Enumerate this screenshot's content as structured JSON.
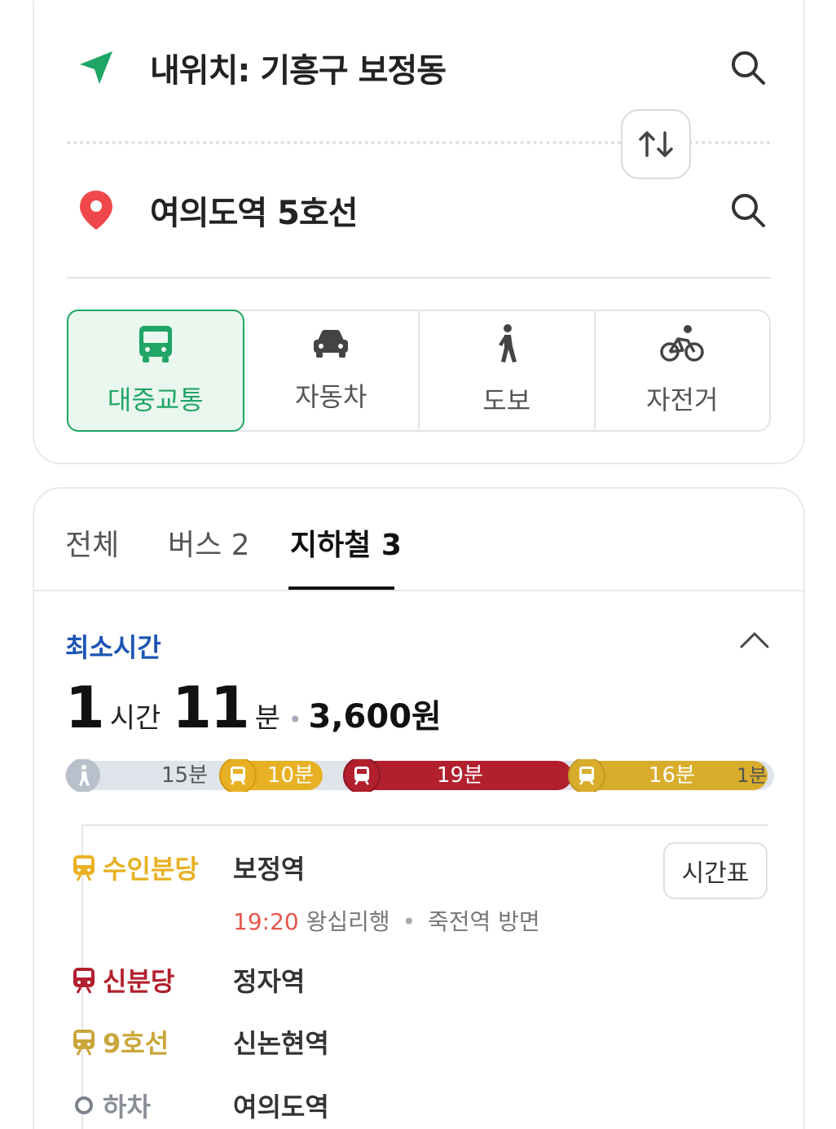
{
  "route": {
    "origin": "내위치: 기흥구 보정동",
    "destination": "여의도역 5호선"
  },
  "modes": [
    {
      "label": "대중교통",
      "icon": "bus-icon",
      "active": true
    },
    {
      "label": "자동차",
      "icon": "car-icon",
      "active": false
    },
    {
      "label": "도보",
      "icon": "walk-icon",
      "active": false
    },
    {
      "label": "자전거",
      "icon": "bicycle-icon",
      "active": false
    }
  ],
  "tabs": [
    {
      "label": "전체"
    },
    {
      "label": "버스 2"
    },
    {
      "label": "지하철 3"
    }
  ],
  "result": {
    "section_title": "최소시간",
    "hours": "1",
    "hours_unit": "시간",
    "minutes": "11",
    "minutes_unit": "분",
    "fare": "3,600원"
  },
  "segments": [
    {
      "mode": "walk",
      "label": "15분",
      "color": "#cfd6e0"
    },
    {
      "mode": "subway",
      "label": "10분",
      "color": "#e8b123"
    },
    {
      "mode": "subway",
      "label": "19분",
      "color": "#b2202e"
    },
    {
      "mode": "subway",
      "label": "16분",
      "color": "#d9ad2c"
    },
    {
      "mode": "walk",
      "label": "1분",
      "color": "#cfd6e0"
    }
  ],
  "steps": [
    {
      "line": "수인분당",
      "station": "보정역",
      "color": "#e8b123"
    },
    {
      "line": "신분당",
      "station": "정자역",
      "color": "#b2202e"
    },
    {
      "line": "9호선",
      "station": "신논현역",
      "color": "#c9a63a"
    },
    {
      "line": "하차",
      "station": "여의도역",
      "color": "#8a8f96"
    }
  ],
  "departure": {
    "time": "19:20",
    "direction": "왕십리행",
    "toward": "죽전역 방면"
  },
  "timetable_label": "시간표",
  "colors": {
    "accent_green": "#1fa564",
    "title_blue": "#1d55b4",
    "time_red": "#e8554f"
  }
}
